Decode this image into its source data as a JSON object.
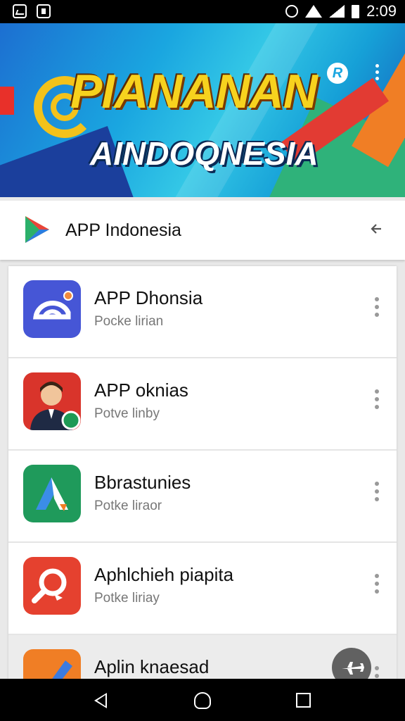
{
  "status_bar": {
    "time": "2:09",
    "icons": [
      "notification-icon",
      "photo-icon",
      "alarm-icon",
      "wifi-icon",
      "signal-icon",
      "battery-icon"
    ]
  },
  "banner": {
    "title": "PIANANAN",
    "subtitle": "AINDOQNESIA",
    "badge_letter": "R",
    "colors": {
      "base": "#1aa6e0",
      "title": "#f7d21e",
      "accent_red": "#e23b33",
      "accent_orange": "#f07e25",
      "accent_green": "#2fb27a"
    }
  },
  "app_bar": {
    "title": "APP Indonesia",
    "back_icon": "back-arrow-icon"
  },
  "apps": [
    {
      "title": "APP Dhonsia",
      "subtitle": "Pocke lirian",
      "icon": "cloud-app-icon",
      "icon_color": "#4656d6"
    },
    {
      "title": "APP oknias",
      "subtitle": "Potve linby",
      "icon": "avatar-app-icon",
      "icon_color": "#d9342b"
    },
    {
      "title": "Bbrastunies",
      "subtitle": "Potke liraor",
      "icon": "arrow-app-icon",
      "icon_color": "#1f9a5b"
    },
    {
      "title": "Aphlchieh piapita",
      "subtitle": "Potke liriay",
      "icon": "search-app-icon",
      "icon_color": "#e5412f"
    },
    {
      "title": "Aplin knaesad",
      "subtitle": "",
      "icon": "check-app-icon",
      "icon_color": "#f07e25"
    }
  ],
  "fab": {
    "icon": "plane-icon"
  }
}
